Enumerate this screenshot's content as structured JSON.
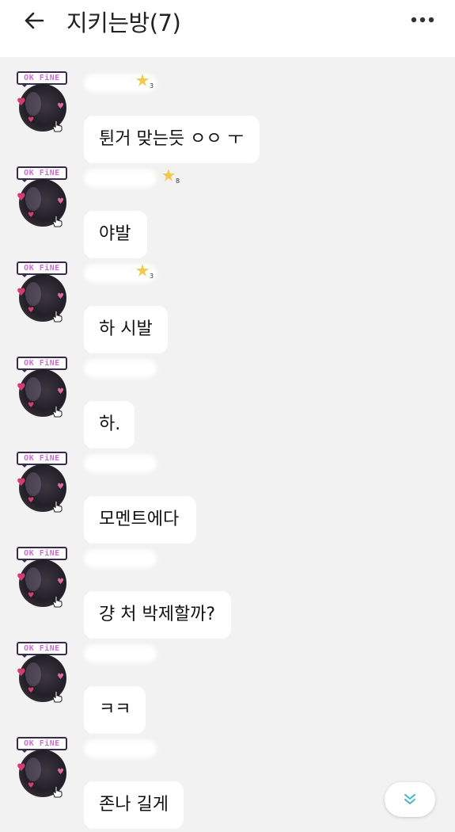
{
  "header": {
    "title": "지키는방(7)",
    "back_icon": "arrow-left-icon",
    "more_icon": "more-horizontal-icon"
  },
  "badge_text": "OK FiNE",
  "messages": [
    {
      "text": "튄거 맞는듯 ㅇㅇ ㅜ",
      "level": "3"
    },
    {
      "text": "야발",
      "level": "8"
    },
    {
      "text": "하 시발",
      "level": "3"
    },
    {
      "text": "하."
    },
    {
      "text": "모멘트에다"
    },
    {
      "text": "걍 처 박제할까?"
    },
    {
      "text": "ㅋㅋ"
    },
    {
      "text": "존나 길게"
    }
  ],
  "scroll_down_icon": "double-chevron-down-icon",
  "colors": {
    "background": "#f2f2f2",
    "bubble": "#ffffff",
    "badge_text": "#d06bd6",
    "heart": "#d83c77",
    "accent_icon": "#3fb7c9"
  }
}
